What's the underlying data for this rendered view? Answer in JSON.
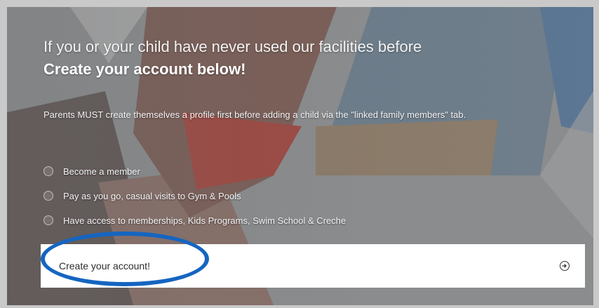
{
  "hero": {
    "subtitle": "If you or your child have never used our facilities before",
    "headline": "Create your account below!",
    "notice": "Parents MUST create themselves a profile first before adding a child via the \"linked family members\" tab."
  },
  "benefits": [
    {
      "label": "Become a member"
    },
    {
      "label": "Pay as you go, casual visits to Gym & Pools"
    },
    {
      "label": "Have access to memberships, Kids Programs, Swim School & Creche"
    }
  ],
  "cta": {
    "label": "Create your account!",
    "icon": "arrow-right-circle-icon"
  },
  "colors": {
    "highlight_ring": "#1565c0",
    "cta_background": "#ffffff",
    "text": "#ffffff"
  }
}
